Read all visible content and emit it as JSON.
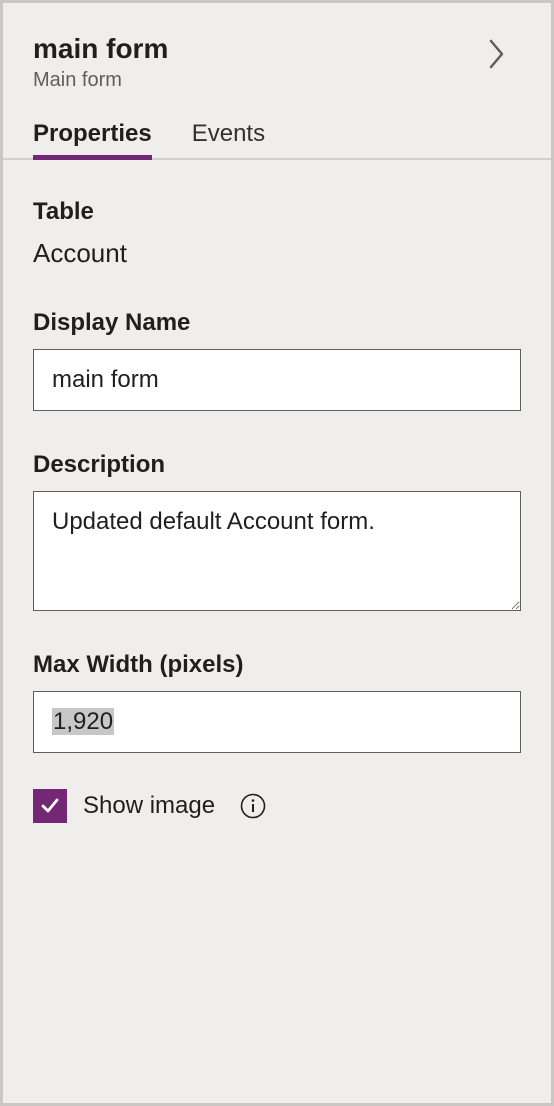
{
  "header": {
    "title": "main form",
    "subtitle": "Main form"
  },
  "tabs": {
    "properties": "Properties",
    "events": "Events"
  },
  "fields": {
    "table": {
      "label": "Table",
      "value": "Account"
    },
    "displayName": {
      "label": "Display Name",
      "value": "main form"
    },
    "description": {
      "label": "Description",
      "value": "Updated default Account form."
    },
    "maxWidth": {
      "label": "Max Width (pixels)",
      "value": "1,920"
    },
    "showImage": {
      "label": "Show image",
      "checked": true
    }
  },
  "colors": {
    "accent": "#742774"
  }
}
